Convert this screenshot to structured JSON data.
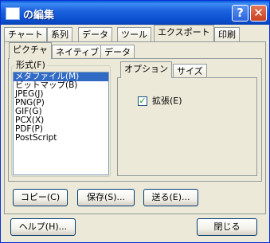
{
  "window": {
    "title": "の編集",
    "help_glyph": "?",
    "close_glyph": "✕"
  },
  "tabs_row1": [
    "チャート",
    "系列",
    "データ",
    "ツール",
    "エクスポート",
    "印刷"
  ],
  "tabs_row2": [
    "ピクチャ",
    "ネイティブ",
    "データ"
  ],
  "format_group": {
    "legend": "形式(F)",
    "items": [
      "メタファイル(M)",
      "ビットマップ(B)",
      "JPEG(J)",
      "PNG(P)",
      "GIF(G)",
      "PCX(X)",
      "PDF(P)",
      "PostScript"
    ],
    "selected_index": 0
  },
  "options_tabs": [
    "オプション",
    "サイズ"
  ],
  "options": {
    "expand_label": "拡張(E)",
    "expand_checked": true,
    "check_glyph": "✓"
  },
  "buttons": {
    "copy": "コピー(C)",
    "save": "保存(S)...",
    "send": "送る(E)...",
    "help": "ヘルプ(H)...",
    "close": "閉じる"
  }
}
